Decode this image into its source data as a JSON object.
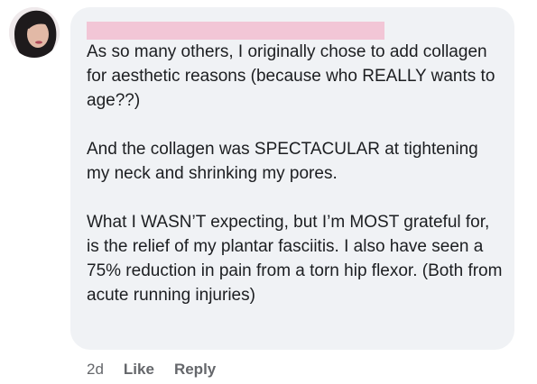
{
  "comment": {
    "paragraphs": [
      "As so many others, I originally chose to add collagen for aesthetic reasons (because who REALLY wants to age??)",
      "And the collagen was SPECTACULAR at tightening my neck and shrinking my pores.",
      "What I WASN’T expecting, but I’m MOST grateful for, is the relief of my plantar fasciitis.  I also have seen a 75% reduction in pain from a torn hip flexor.  (Both from acute running injuries)"
    ]
  },
  "actions": {
    "timestamp": "2d",
    "like_label": "Like",
    "reply_label": "Reply"
  },
  "colors": {
    "bubble": "#f0f2f5",
    "text": "#1c1e21",
    "meta": "#65676b",
    "redaction": "#f2c6d6"
  }
}
